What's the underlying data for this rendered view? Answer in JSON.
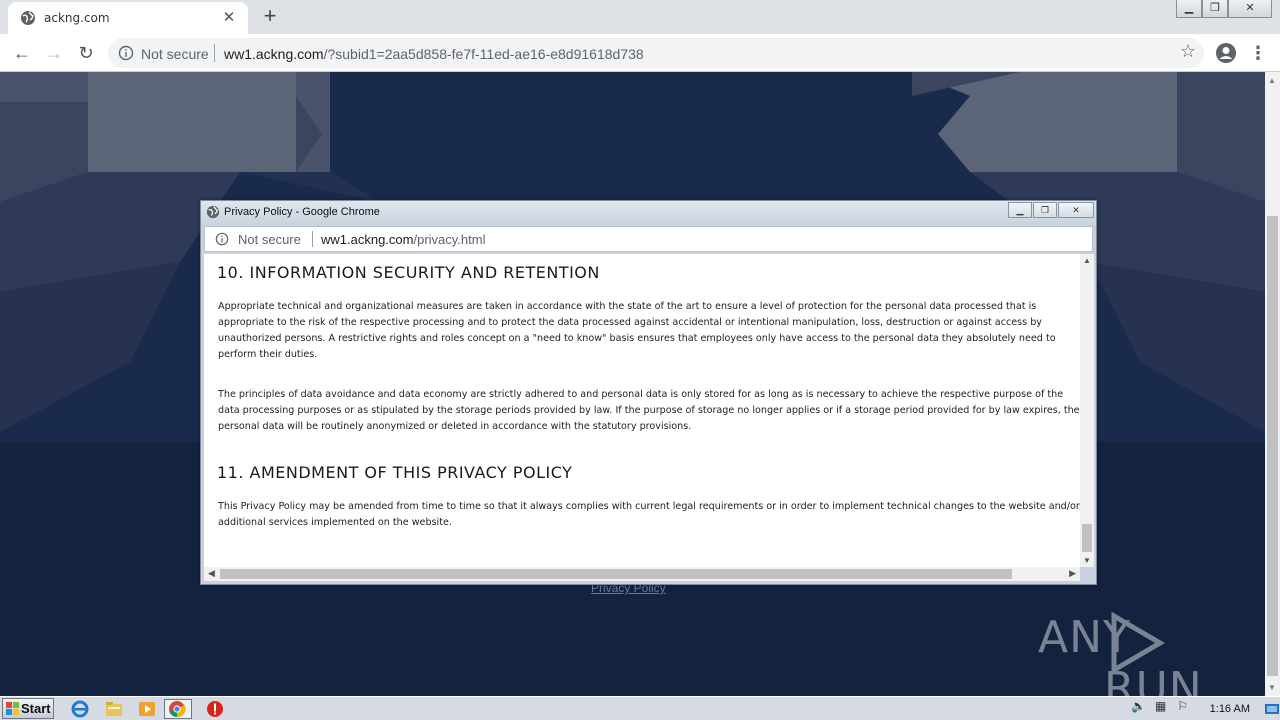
{
  "browser": {
    "tab_title": "ackng.com",
    "new_tab_symbol": "+",
    "omnibox": {
      "security_label": "Not secure",
      "url_host": "ww1.ackng.com",
      "url_path": "/?subid1=2aa5d858-fe7f-11ed-ae16-e8d91618d738"
    }
  },
  "page": {
    "footer_link": "Privacy Policy",
    "watermark_left": "ANY",
    "watermark_right": "RUN"
  },
  "popup": {
    "window_title": "Privacy Policy - Google Chrome",
    "security_label": "Not secure",
    "url_host": "ww1.ackng.com",
    "url_path": "/privacy.html",
    "sections": [
      {
        "heading": "10. INFORMATION SECURITY AND RETENTION",
        "paragraphs": [
          "Appropriate technical and organizational measures are taken in accordance with the state of the art to ensure a level of protection for the personal data processed that is appropriate to the risk of the respective processing and to protect the data processed against accidental or intentional manipulation, loss, destruction or against access by unauthorized persons. A restrictive rights and roles concept on a \"need to know\" basis ensures that employees only have access to the personal data they absolutely need to perform their duties.",
          "The principles of data avoidance and data economy are strictly adhered to and personal data is only stored for as long as is necessary to achieve the respective purpose of the data processing purposes or as stipulated by the storage periods provided by law. If the purpose of storage no longer applies or if a storage period provided for by law expires, the personal data will be routinely anonymized or deleted in accordance with the statutory provisions."
        ]
      },
      {
        "heading": "11. AMENDMENT OF THIS PRIVACY POLICY",
        "paragraphs": [
          "This Privacy Policy may be amended from time to time so that it always complies with current legal requirements or in order to implement technical changes to the website and/or additional services implemented on the website."
        ]
      }
    ]
  },
  "taskbar": {
    "start_label": "Start",
    "clock": "1:16 AM",
    "pinned_icons": [
      "internet-explorer-icon",
      "file-explorer-icon",
      "media-player-icon",
      "chrome-icon",
      "stop-icon"
    ]
  },
  "colors": {
    "page_bg": "#13223f",
    "chrome_bg": "#dee1e6",
    "popup_frame": "#c8d1dd"
  }
}
